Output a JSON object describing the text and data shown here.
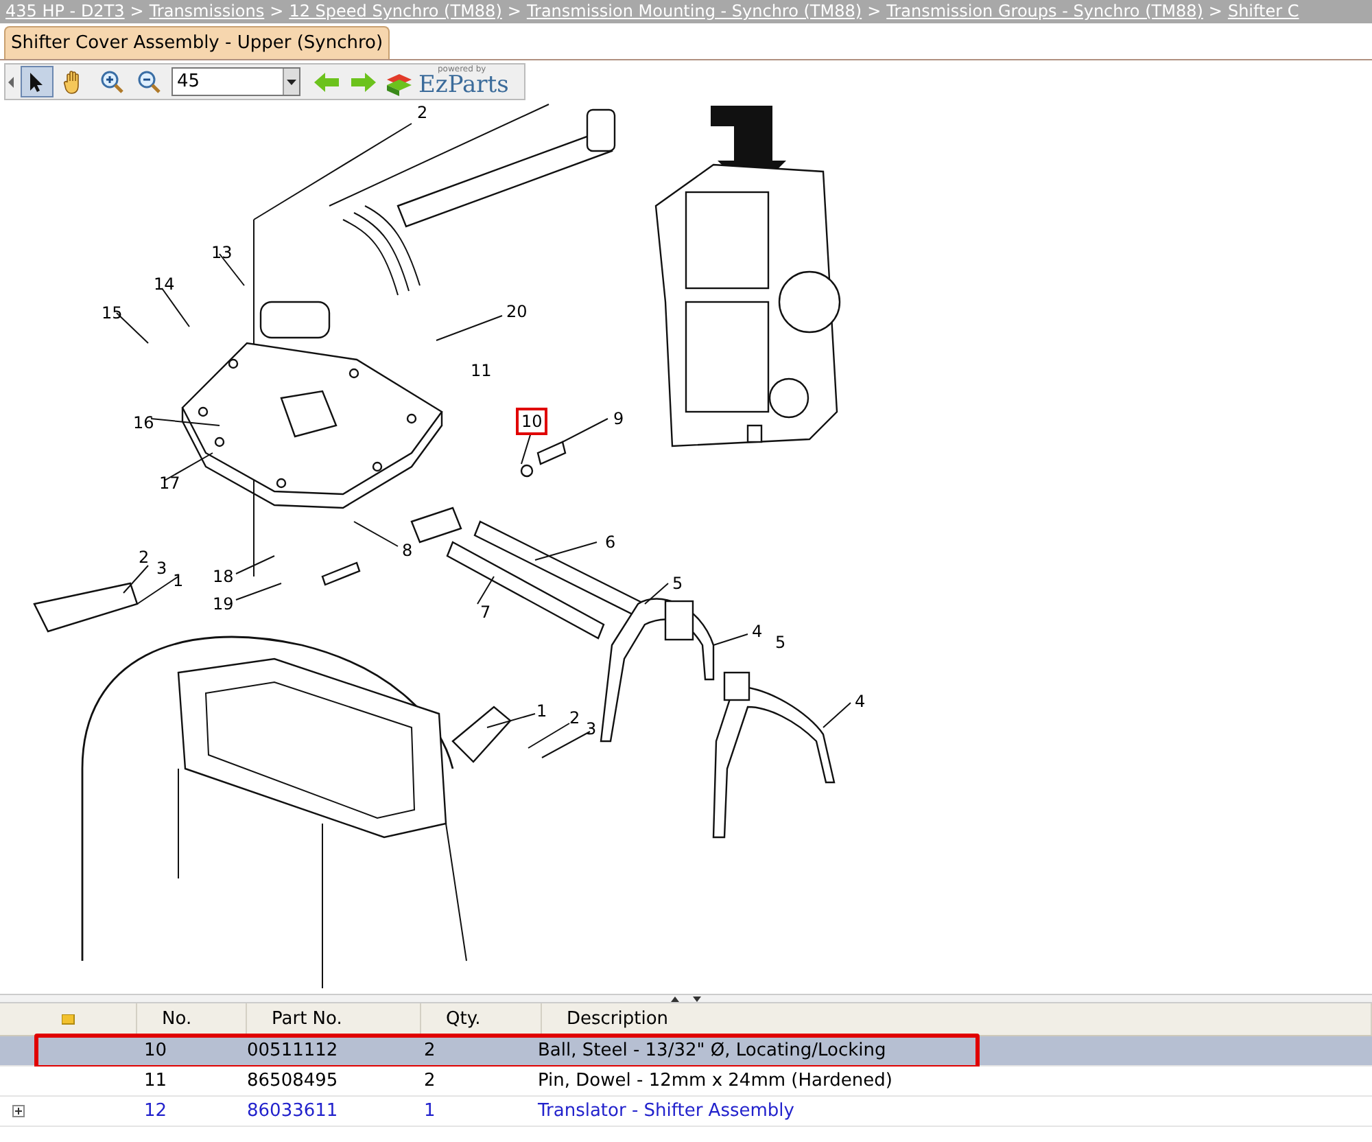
{
  "breadcrumb": {
    "separator": ">",
    "items": [
      "435 HP - D2T3",
      "Transmissions",
      "12 Speed Synchro (TM88)",
      "Transmission Mounting - Synchro (TM88)",
      "Transmission Groups - Synchro (TM88)",
      "Shifter C"
    ]
  },
  "tab": {
    "label": "Shifter Cover Assembly - Upper (Synchro)",
    "selected": true
  },
  "toolbar": {
    "tools": [
      {
        "kind": "pointer",
        "selected": true
      },
      {
        "kind": "pan",
        "selected": false
      },
      {
        "kind": "zoom-in",
        "selected": false
      },
      {
        "kind": "zoom-out",
        "selected": false
      }
    ],
    "zoom": {
      "value": "45"
    },
    "logo": {
      "tagline": "powered by",
      "name": "EzParts"
    }
  },
  "diagram": {
    "callouts": [
      {
        "label": "2",
        "highlighted": false
      },
      {
        "label": "13",
        "highlighted": false
      },
      {
        "label": "14",
        "highlighted": false
      },
      {
        "label": "15",
        "highlighted": false
      },
      {
        "label": "20",
        "highlighted": false
      },
      {
        "label": "11",
        "highlighted": false
      },
      {
        "label": "16",
        "highlighted": false
      },
      {
        "label": "10",
        "highlighted": true
      },
      {
        "label": "9",
        "highlighted": false
      },
      {
        "label": "17",
        "highlighted": false
      },
      {
        "label": "8",
        "highlighted": false
      },
      {
        "label": "6",
        "highlighted": false
      },
      {
        "label": "2",
        "highlighted": false
      },
      {
        "label": "3",
        "highlighted": false
      },
      {
        "label": "1",
        "highlighted": false
      },
      {
        "label": "18",
        "highlighted": false
      },
      {
        "label": "19",
        "highlighted": false
      },
      {
        "label": "5",
        "highlighted": false
      },
      {
        "label": "7",
        "highlighted": false
      },
      {
        "label": "4",
        "highlighted": false
      },
      {
        "label": "5",
        "highlighted": false
      },
      {
        "label": "4",
        "highlighted": false
      },
      {
        "label": "1",
        "highlighted": false
      },
      {
        "label": "2",
        "highlighted": false
      },
      {
        "label": "3",
        "highlighted": false
      }
    ]
  },
  "table": {
    "columns": [
      "No.",
      "Part No.",
      "Qty.",
      "Description"
    ],
    "rows": [
      {
        "kind": "part",
        "no": "10",
        "part_no": "00511112",
        "qty": "2",
        "description": "Ball, Steel - 13/32\" Ø, Locating/Locking",
        "selected": true,
        "highlighted": true
      },
      {
        "kind": "part",
        "no": "11",
        "part_no": "86508495",
        "qty": "2",
        "description": "Pin, Dowel - 12mm x 24mm (Hardened)",
        "selected": false,
        "highlighted": false
      },
      {
        "kind": "assembly",
        "no": "12",
        "part_no": "86033611",
        "qty": "1",
        "description": "Translator - Shifter Assembly",
        "selected": false,
        "highlighted": false
      }
    ]
  }
}
